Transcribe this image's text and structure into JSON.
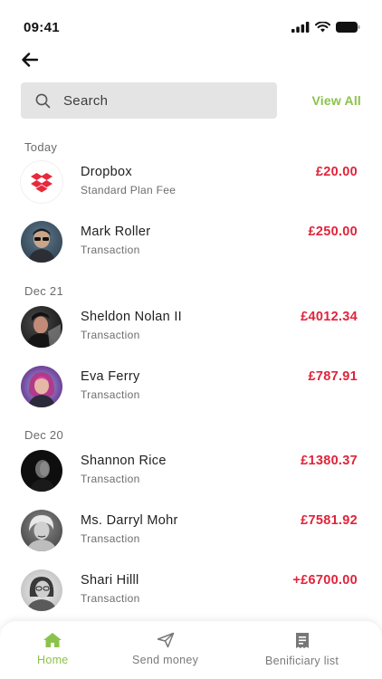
{
  "status_bar": {
    "time": "09:41"
  },
  "search": {
    "placeholder": "Search",
    "value": ""
  },
  "view_all_label": "View All",
  "sections": [
    {
      "label": "Today"
    },
    {
      "label": "Dec 21"
    },
    {
      "label": "Dec 20"
    }
  ],
  "transactions": [
    {
      "name": "Dropbox",
      "subtitle": "Standard Plan Fee",
      "amount": "£20.00",
      "avatar": "dropbox-logo-icon"
    },
    {
      "name": "Mark Roller",
      "subtitle": "Transaction",
      "amount": "£250.00",
      "avatar": "user-photo"
    },
    {
      "name": "Sheldon Nolan II",
      "subtitle": "Transaction",
      "amount": "£4012.34",
      "avatar": "user-photo"
    },
    {
      "name": "Eva Ferry",
      "subtitle": "Transaction",
      "amount": "£787.91",
      "avatar": "user-photo"
    },
    {
      "name": "Shannon Rice",
      "subtitle": "Transaction",
      "amount": "£1380.37",
      "avatar": "user-photo"
    },
    {
      "name": "Ms. Darryl Mohr",
      "subtitle": "Transaction",
      "amount": "£7581.92",
      "avatar": "user-photo"
    },
    {
      "name": "Shari Hilll",
      "subtitle": "Transaction",
      "amount": "+£6700.00",
      "avatar": "user-photo"
    }
  ],
  "tabs": [
    {
      "label": "Home",
      "icon": "home-icon",
      "active": true
    },
    {
      "label": "Send money",
      "icon": "send-icon",
      "active": false
    },
    {
      "label": "Benificiary list",
      "icon": "receipt-icon",
      "active": false
    }
  ],
  "colors": {
    "accent": "#8bc34a",
    "amount": "#e0243a",
    "search_bg": "#e4e4e4"
  }
}
